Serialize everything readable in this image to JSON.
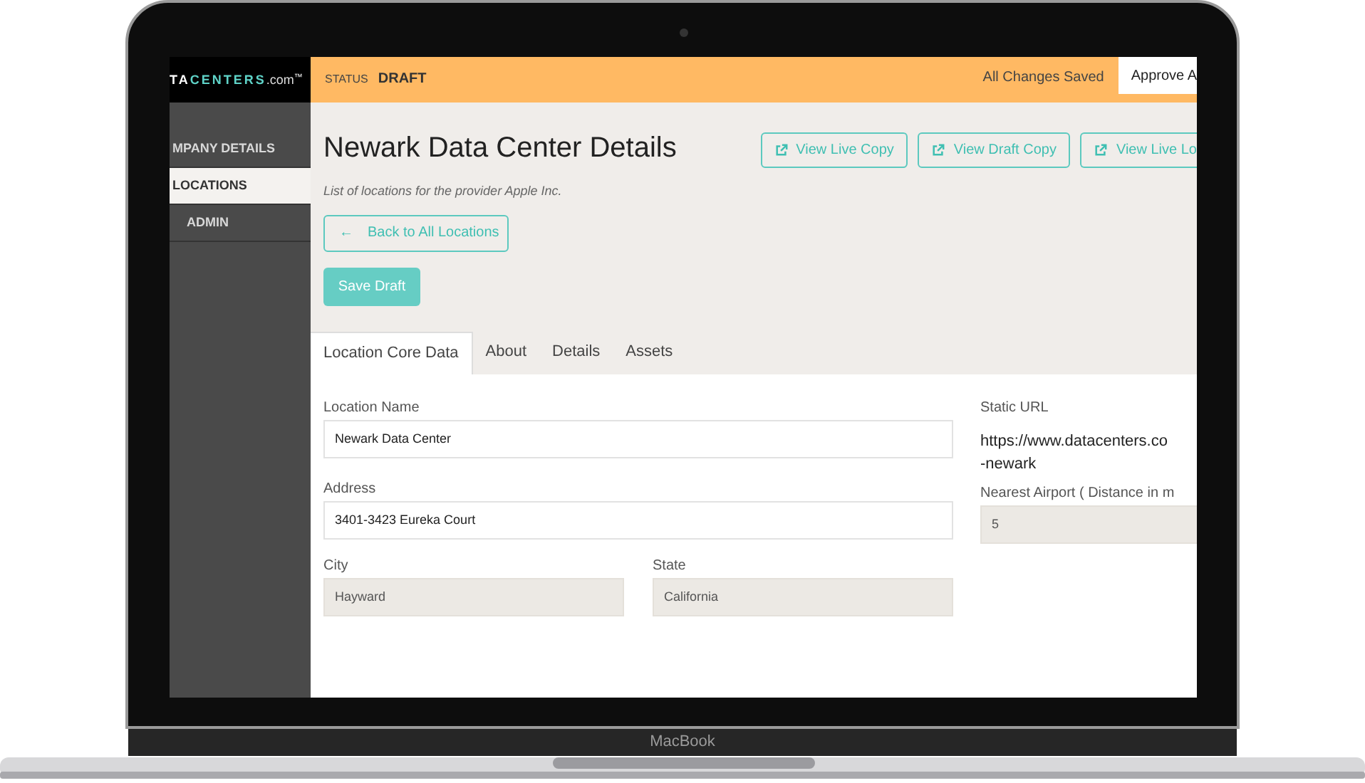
{
  "device": {
    "label": "MacBook"
  },
  "topbar": {
    "logo": {
      "lead": "TA",
      "accent": "CENTERS",
      "suffix": ".com",
      "mark": "™"
    },
    "status_label": "STATUS",
    "status": "DRAFT",
    "save_state": "All Changes Saved",
    "approve_button": "Approve A"
  },
  "sidebar": {
    "items": [
      {
        "label": "MPANY DETAILS",
        "selected": false,
        "indented": false
      },
      {
        "label": "LOCATIONS",
        "selected": true,
        "indented": false
      },
      {
        "label": "ADMIN",
        "selected": false,
        "indented": true
      }
    ]
  },
  "page": {
    "title": "Newark Data Center Details",
    "subtitle": "List of locations for the provider Apple Inc.",
    "view_buttons": [
      "View Live Copy",
      "View Draft Copy",
      "View Live Lo"
    ],
    "back_button": {
      "icon": "←",
      "label": "Back to All Locations"
    },
    "save_button": "Save Draft"
  },
  "tabs": [
    {
      "label": "Location Core Data",
      "selected": true
    },
    {
      "label": "About",
      "selected": false
    },
    {
      "label": "Details",
      "selected": false
    },
    {
      "label": "Assets",
      "selected": false
    }
  ],
  "form": {
    "wide_fields": [
      {
        "label": "Location Name",
        "value": "Newark Data Center",
        "readonly": false
      },
      {
        "label": "Address",
        "value": "3401-3423 Eureka Court",
        "readonly": false
      }
    ],
    "half_fields": [
      {
        "label": "City",
        "value": "Hayward",
        "readonly": true
      },
      {
        "label": "State",
        "value": "California",
        "readonly": true
      }
    ],
    "static_url": {
      "label": "Static URL",
      "lines": [
        "https://www.datacenters.co",
        "-newark"
      ]
    },
    "side_fields": [
      {
        "label": "Nearest Airport ( Distance in m",
        "value": "5",
        "readonly": true
      }
    ]
  }
}
